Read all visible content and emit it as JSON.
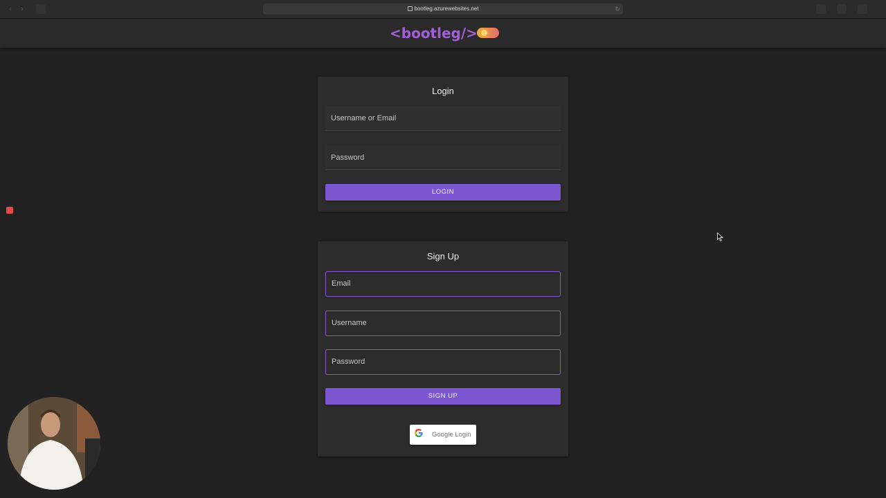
{
  "browser": {
    "url": "bootleg.azurewebsites.net"
  },
  "header": {
    "brand": "<bootleg/>",
    "toggle_icon": "theme-toggle-icon"
  },
  "login": {
    "title": "Login",
    "username_placeholder": "Username or Email",
    "password_placeholder": "Password",
    "button_label": "LOGIN"
  },
  "signup": {
    "title": "Sign Up",
    "email_placeholder": "Email",
    "username_placeholder": "Username",
    "password_placeholder": "Password",
    "button_label": "SIGN UP"
  },
  "google": {
    "label": "Google Login"
  },
  "colors": {
    "background": "#222222",
    "brand": "#a25fd6",
    "accent": "#7d57d1",
    "card": "#2c2c2c"
  }
}
